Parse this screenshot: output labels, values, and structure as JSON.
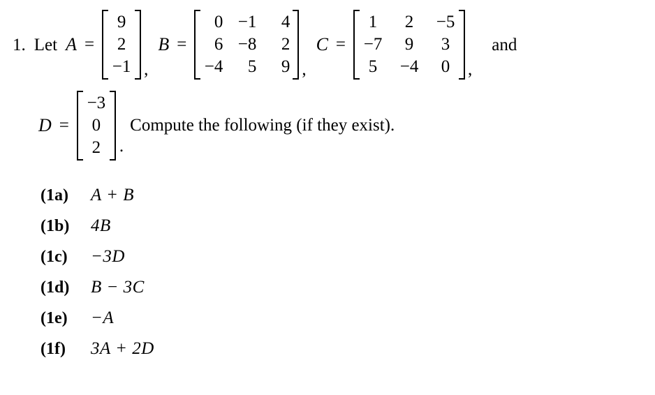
{
  "document": {
    "problem_number": "1.",
    "lead_text": "Let",
    "separator_comma": ",",
    "period": ".",
    "and_text": "and",
    "equals": "=",
    "instruction": "Compute the following (if they exist)."
  },
  "matrices": [
    {
      "name": "A",
      "rows": 3,
      "cols": 1,
      "align": "center",
      "values": [
        [
          "9"
        ],
        [
          "2"
        ],
        [
          "−1"
        ]
      ]
    },
    {
      "name": "B",
      "rows": 3,
      "cols": 3,
      "align": "right",
      "values": [
        [
          "0",
          "−1",
          "4"
        ],
        [
          "6",
          "−8",
          "2"
        ],
        [
          "−4",
          "5",
          "9"
        ]
      ]
    },
    {
      "name": "C",
      "rows": 3,
      "cols": 3,
      "align": "center",
      "values": [
        [
          "1",
          "2",
          "−5"
        ],
        [
          "−7",
          "9",
          "3"
        ],
        [
          "5",
          "−4",
          "0"
        ]
      ]
    },
    {
      "name": "D",
      "rows": 3,
      "cols": 1,
      "align": "center",
      "values": [
        [
          "−3"
        ],
        [
          "0"
        ],
        [
          "2"
        ]
      ]
    }
  ],
  "subitems": [
    {
      "tag": "(1a)",
      "expression": "A + B"
    },
    {
      "tag": "(1b)",
      "expression": "4B"
    },
    {
      "tag": "(1c)",
      "expression": "−3D"
    },
    {
      "tag": "(1d)",
      "expression": "B − 3C"
    },
    {
      "tag": "(1e)",
      "expression": "−A"
    },
    {
      "tag": "(1f)",
      "expression": "3A + 2D"
    }
  ],
  "colors": {
    "text": "#000000",
    "background": "#ffffff"
  }
}
